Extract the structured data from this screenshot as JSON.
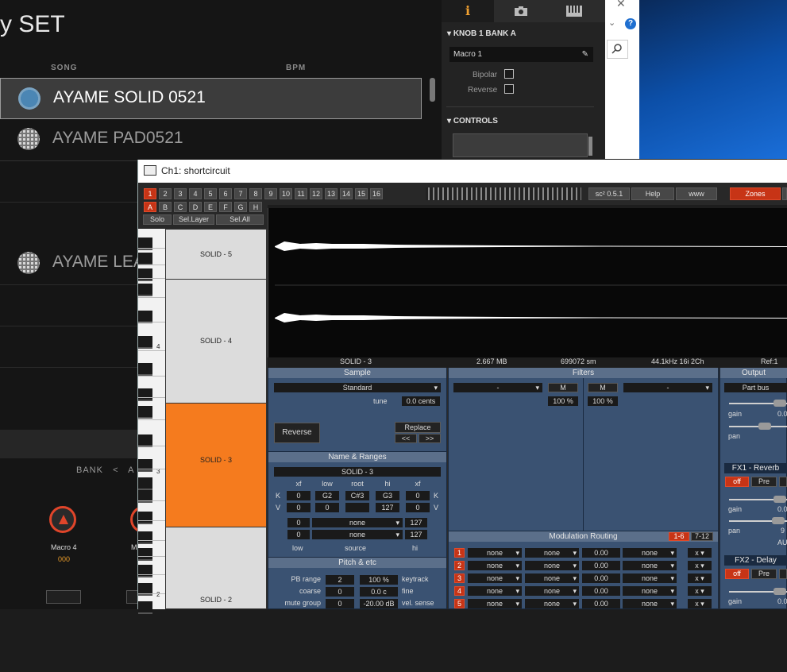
{
  "bg_app": {
    "title": "y SET",
    "col_song": "SONG",
    "col_bpm": "BPM",
    "songs": [
      {
        "name": "AYAME SOLID 0521"
      },
      {
        "name": "AYAME PAD0521"
      },
      {
        "name": "AYAME LEA"
      }
    ],
    "bank_label": "BANK",
    "bank_prev": "<",
    "bank_value": "A",
    "macro_label": "Macro 4",
    "macro_value": "000",
    "macro_label2": "M"
  },
  "right_panel": {
    "tab_info": "i",
    "knob_head": "KNOB 1  BANK A",
    "macro_field": "Macro 1",
    "bipolar_label": "Bipolar",
    "reverse_label": "Reverse",
    "controls_head": "CONTROLS"
  },
  "window": {
    "title": "Ch1: shortcircuit",
    "numbers": [
      "1",
      "2",
      "3",
      "4",
      "5",
      "6",
      "7",
      "8",
      "9",
      "10",
      "11",
      "12",
      "13",
      "14",
      "15",
      "16"
    ],
    "letters": [
      "A",
      "B",
      "C",
      "D",
      "E",
      "F",
      "G",
      "H"
    ],
    "solo": "Solo",
    "sel_layer": "Sel.Layer",
    "sel_all": "Sel.All",
    "version": "sc² 0.5.1",
    "help": "Help",
    "www": "www",
    "zones": "Zones",
    "zone_marker": "S"
  },
  "keyboard": {
    "octave_labels": [
      "4",
      "3",
      "2"
    ],
    "zones": [
      "SOLID - 5",
      "SOLID - 4",
      "SOLID - 3",
      "SOLID - 2"
    ]
  },
  "wave_info": {
    "name": "SOLID - 3",
    "size": "2.667 MB",
    "samples": "699072 sm",
    "format": "44.1kHz 16i 2Ch",
    "ref": "Ref:1"
  },
  "sample": {
    "head": "Sample",
    "mode": "Standard",
    "tune_label": "tune",
    "tune_value": "0.0 cents",
    "reverse": "Reverse",
    "replace": "Replace",
    "prev": "<<",
    "next": ">>"
  },
  "filters": {
    "head": "Filters",
    "f1": "-",
    "m1": "M",
    "mix1": "100 %",
    "m2": "M",
    "mix2": "100 %",
    "f2": "-"
  },
  "output": {
    "head": "Output",
    "bus": "Part bus",
    "gain": "gain",
    "pan": "pan",
    "gain_val": "0.0",
    "fx1": "FX1 - Reverb",
    "fx1_off": "off",
    "fx1_pre": "Pre",
    "fx1_gain": "gain",
    "fx1_gain_val": "0.0",
    "fx1_pan": "pan",
    "fx1_pan_val": "9",
    "fx1_au": "AU",
    "fx2": "FX2 - Delay",
    "fx2_off": "off",
    "fx2_pre": "Pre",
    "fx2_gain": "gain",
    "fx2_gain_val": "0.0"
  },
  "name_ranges": {
    "head": "Name & Ranges",
    "name": "SOLID - 3",
    "cols": [
      "xf",
      "low",
      "root",
      "hi",
      "xf"
    ],
    "k_row": [
      "0",
      "G2",
      "C#3",
      "G3",
      "0"
    ],
    "v_row": [
      "0",
      "0",
      "",
      "127",
      "0"
    ],
    "k": "K",
    "v": "V",
    "src_rows": [
      {
        "low": "0",
        "src": "none",
        "hi": "127"
      },
      {
        "low": "0",
        "src": "none",
        "hi": "127"
      }
    ],
    "low_lbl": "low",
    "src_lbl": "source",
    "hi_lbl": "hi"
  },
  "pitch": {
    "head": "Pitch & etc",
    "rows": [
      {
        "label": "PB range",
        "v1": "2",
        "v2": "100 %",
        "right": "keytrack"
      },
      {
        "label": "coarse",
        "v1": "0",
        "v2": "0.0 c",
        "right": "fine"
      },
      {
        "label": "mute group",
        "v1": "0",
        "v2": "-20.00 dB",
        "right": "vel. sense"
      }
    ]
  },
  "mod": {
    "head": "Modulation Routing",
    "tab1": "1-6",
    "tab2": "7-12",
    "rows": [
      {
        "n": "1",
        "src": "none",
        "src2": "none",
        "amt": "0.00",
        "dst": "none",
        "x": "x"
      },
      {
        "n": "2",
        "src": "none",
        "src2": "none",
        "amt": "0.00",
        "dst": "none",
        "x": "x"
      },
      {
        "n": "3",
        "src": "none",
        "src2": "none",
        "amt": "0.00",
        "dst": "none",
        "x": "x"
      },
      {
        "n": "4",
        "src": "none",
        "src2": "none",
        "amt": "0.00",
        "dst": "none",
        "x": "x"
      },
      {
        "n": "5",
        "src": "none",
        "src2": "none",
        "amt": "0.00",
        "dst": "none",
        "x": "x"
      }
    ]
  }
}
